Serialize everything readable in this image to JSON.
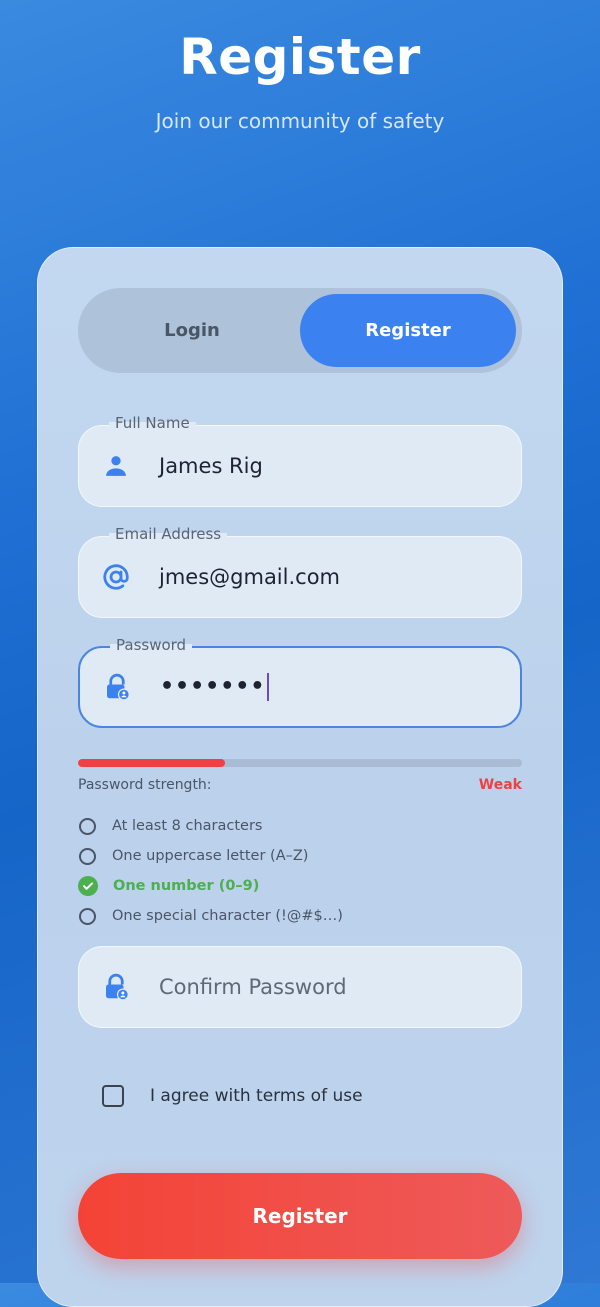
{
  "header": {
    "title": "Register",
    "subtitle": "Join our community of safety"
  },
  "tabs": {
    "login_label": "Login",
    "register_label": "Register",
    "active": "register"
  },
  "form": {
    "full_name": {
      "label": "Full Name",
      "value": "James Rig",
      "icon": "person-icon"
    },
    "email": {
      "label": "Email Address",
      "value": "jmes@gmail.com",
      "icon": "at-icon"
    },
    "password": {
      "label": "Password",
      "value": "•••••••",
      "icon": "lock-icon",
      "focused": true
    },
    "strength": {
      "label": "Password strength:",
      "value": "Weak",
      "level": 0.33,
      "color": "#ee4242"
    },
    "requirements": [
      {
        "label": "At least 8 characters",
        "met": false
      },
      {
        "label": "One uppercase letter (A–Z)",
        "met": false
      },
      {
        "label": "One number (0–9)",
        "met": true
      },
      {
        "label": "One special character (!@#$…)",
        "met": false
      }
    ],
    "confirm_password": {
      "placeholder": "Confirm Password",
      "icon": "lock-icon"
    },
    "agree_label": "I agree with terms of use",
    "agree_checked": false,
    "submit_label": "Register"
  },
  "colors": {
    "accent": "#3b82f0",
    "danger": "#ee4242",
    "success": "#4caf50"
  }
}
